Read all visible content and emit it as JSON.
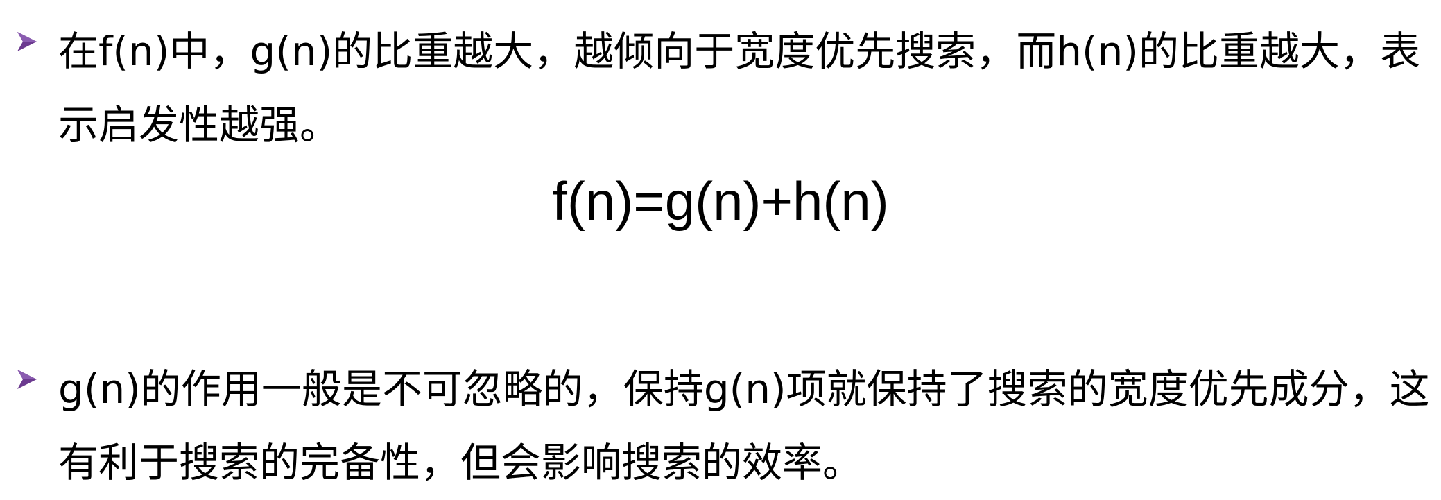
{
  "bullets": [
    {
      "icon": "triangle-arrow-bullet-icon",
      "text": "在f(n)中，g(n)的比重越大，越倾向于宽度优先搜索，而h(n)的比重越大，表示启发性越强。"
    },
    {
      "icon": "triangle-arrow-bullet-icon",
      "text": "g(n)的作用一般是不可忽略的，保持g(n)项就保持了搜索的宽度优先成分，这有利于搜索的完备性，但会影响搜索的效率。"
    }
  ],
  "formula": "f(n)=g(n)+h(n)",
  "colors": {
    "bullet": "#6b3a8f",
    "text": "#000000",
    "background": "#ffffff"
  }
}
